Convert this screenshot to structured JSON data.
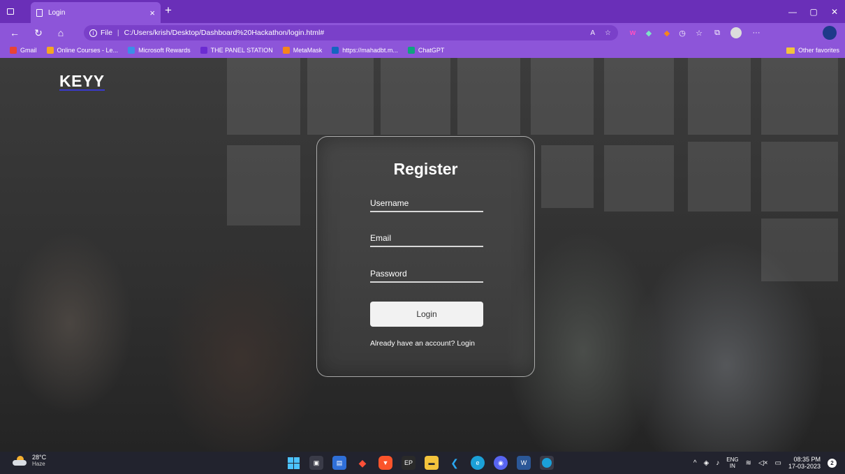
{
  "browser": {
    "tab_title": "Login",
    "tab_close": "×",
    "new_tab": "+",
    "url_prefix": "File",
    "url": "C:/Users/krish/Desktop/Dashboard%20Hackathon/login.html#",
    "bookmarks": [
      {
        "label": "Gmail",
        "color": "#ea4335"
      },
      {
        "label": "Online Courses - Le...",
        "color": "#f5a623"
      },
      {
        "label": "Microsoft Rewards",
        "color": "#3c8ee8"
      },
      {
        "label": "THE PANEL STATION",
        "color": "#6b2bd1"
      },
      {
        "label": "MetaMask",
        "color": "#f6851b"
      },
      {
        "label": "https://mahadbt.m...",
        "color": "#1565c0"
      },
      {
        "label": "ChatGPT",
        "color": "#10a37f"
      }
    ],
    "other_favorites": "Other favorites"
  },
  "page": {
    "brand": "KEYY",
    "card": {
      "title": "Register",
      "username_label": "Username",
      "email_label": "Email",
      "password_label": "Password",
      "login_button": "Login",
      "switch_text": "Already have an account? Login"
    }
  },
  "taskbar": {
    "temperature": "28°C",
    "condition": "Haze",
    "lang_top": "ENG",
    "lang_bottom": "IN",
    "time": "08:35 PM",
    "date": "17-03-2023",
    "notification_count": "2"
  },
  "colors": {
    "browser_accent": "#8d55d9",
    "tabbar": "#6a2fb8",
    "taskbar": "#22232e"
  }
}
